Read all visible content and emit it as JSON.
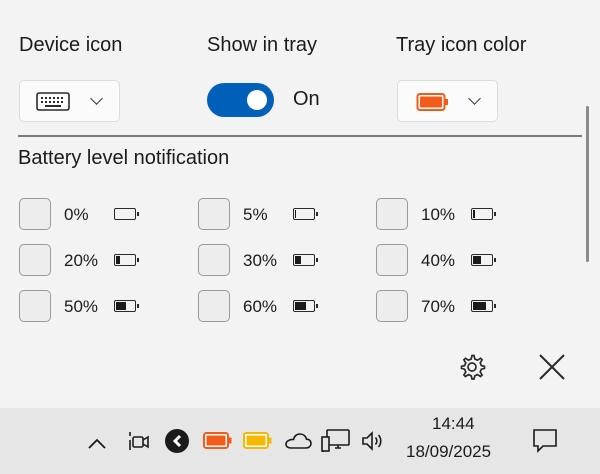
{
  "settings": {
    "device_icon": {
      "label": "Device icon",
      "icon": "keyboard-icon"
    },
    "show_in_tray": {
      "label": "Show in tray",
      "state_label": "On",
      "enabled": true
    },
    "tray_icon_color": {
      "label": "Tray icon color",
      "color": "#f25c1a"
    }
  },
  "notifications": {
    "title": "Battery level notification",
    "levels": [
      {
        "label": "0%",
        "fill": 0
      },
      {
        "label": "5%",
        "fill": 0.05
      },
      {
        "label": "10%",
        "fill": 0.1
      },
      {
        "label": "20%",
        "fill": 0.2
      },
      {
        "label": "30%",
        "fill": 0.3
      },
      {
        "label": "40%",
        "fill": 0.4
      },
      {
        "label": "50%",
        "fill": 0.5
      },
      {
        "label": "60%",
        "fill": 0.6
      },
      {
        "label": "70%",
        "fill": 0.7
      }
    ]
  },
  "footer": {
    "gear": "gear-icon",
    "close": "close-icon"
  },
  "taskbar": {
    "icons": [
      "chevron-up-icon",
      "video-camera-icon",
      "g-logo-icon",
      "battery-orange-icon",
      "battery-yellow-icon",
      "cloud-icon",
      "network-icon",
      "volume-icon"
    ],
    "time": "14:44",
    "date": "18/09/2025",
    "notification": "notification-icon"
  },
  "colors": {
    "accent": "#005fb8",
    "orange": "#f25c1a",
    "yellow": "#f5b800"
  }
}
